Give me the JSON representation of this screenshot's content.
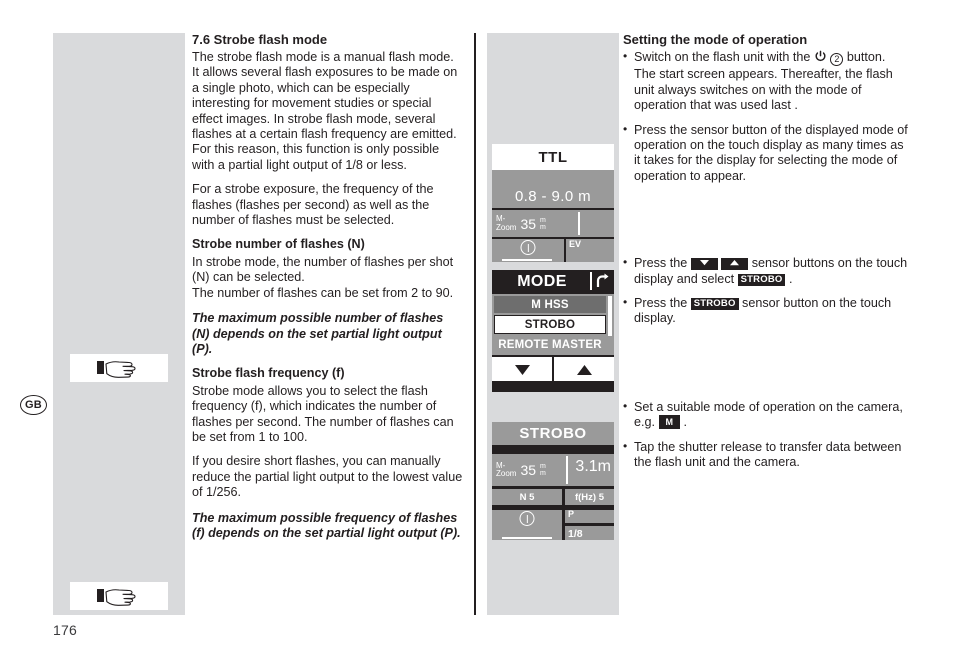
{
  "page": {
    "number": "176",
    "language_badge": "GB"
  },
  "left_column": {
    "heading": "7.6 Strobe flash mode",
    "paragraph_1": "The strobe flash mode is a manual flash mode. It allows several flash exposures to be made on a single photo, which can be especially interesting for movement studies or special effect images. In strobe flash mode, several flashes at a certain flash frequency are emitted. For this reason, this function is only possible with a partial light output of 1/8 or less.",
    "paragraph_2": "For a strobe exposure, the frequency of the flashes (flashes per second) as well as the number of flashes must be selected.",
    "subheading_1": "Strobe number of flashes (N)",
    "paragraph_3": "In strobe mode, the number of flashes per shot (N) can be selected.",
    "paragraph_4": "The number of flashes can be set from 2 to 90.",
    "note_1": "The maximum possible number of flashes (N) depends on the set partial light output (P).",
    "subheading_2": "Strobe flash frequency (f)",
    "paragraph_5": "Strobe mode allows you to select the flash frequency (f), which indicates the number of flashes per second. The number of flashes can be set from 1 to 100.",
    "paragraph_6": "If you desire short flashes, you can manually reduce the partial light output to the lowest value of 1/256.",
    "note_2": "The maximum possible frequency of flashes (f) depends on the set partial light output (P)."
  },
  "right_column": {
    "heading": "Setting the mode of operation",
    "bullets": [
      {
        "text_before": "Switch on the flash unit with the",
        "icon": "power-icon",
        "ref_number": "2",
        "text_after": "button.",
        "sub_text": "The start screen appears. Thereafter, the flash unit always switches on with the mode of operation that was used last ."
      },
      {
        "text": "Press the sensor button of the displayed mode of operation on the touch display as many times as it takes for the display for selecting the mode of operation to appear."
      },
      {
        "text_before": "Press the",
        "icon_down": "arrow-down-icon",
        "icon_up": "arrow-up-icon",
        "text_mid": "sensor buttons on the touch display and select",
        "chip": "STROBO",
        "text_after": "."
      },
      {
        "text_before": "Press the",
        "chip": "STROBO",
        "text_after": "sensor button on the touch display."
      },
      {
        "text_before": "Set a suitable mode of operation on the camera, e.g.",
        "chip": "M",
        "text_after": "."
      },
      {
        "text": "Tap the shutter release to transfer data between the flash unit and the camera."
      }
    ]
  },
  "displays": {
    "ttl": {
      "title": "TTL",
      "distance": "0.8 - 9.0 m",
      "zoom_label_line1": "M-",
      "zoom_label_line2": "Zoom",
      "zoom_value": "35",
      "zoom_unit_line1": "m",
      "zoom_unit_line2": "m",
      "ev_label": "EV",
      "info_icon": "info-icon"
    },
    "mode": {
      "title": "MODE",
      "back_icon": "back-arrow-icon",
      "items": [
        {
          "label": "M HSS",
          "state": "dim"
        },
        {
          "label": "STROBO",
          "state": "selected"
        },
        {
          "label": "REMOTE MASTER",
          "state": "normal"
        }
      ],
      "nav_down_icon": "triangle-down-icon",
      "nav_up_icon": "triangle-up-icon"
    },
    "strobo": {
      "title": "STROBO",
      "zoom_label_line1": "M-",
      "zoom_label_line2": "Zoom",
      "zoom_value": "35",
      "zoom_unit_line1": "m",
      "zoom_unit_line2": "m",
      "distance": "3.1m",
      "flashes_label": "N 5",
      "frequency_label": "f(Hz) 5",
      "power_label": "P",
      "power_value": "1/8",
      "info_icon": "info-icon"
    }
  }
}
